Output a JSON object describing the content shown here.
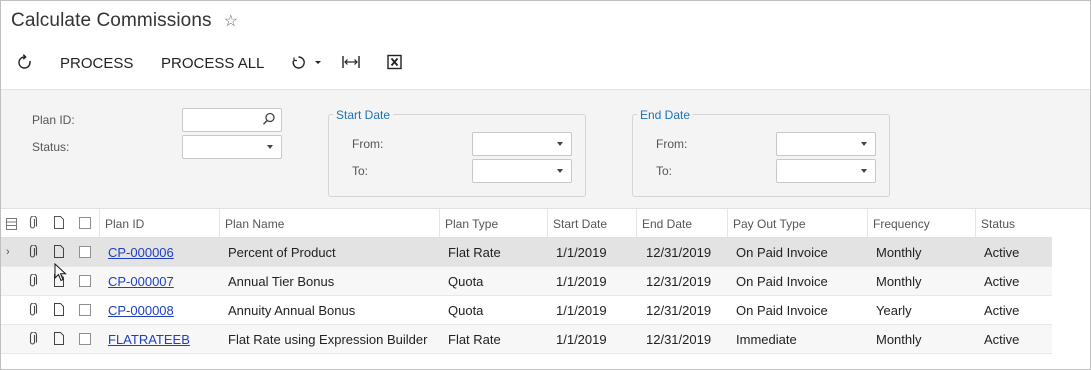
{
  "page": {
    "title": "Calculate Commissions"
  },
  "toolbar": {
    "process_label": "PROCESS",
    "process_all_label": "PROCESS ALL"
  },
  "filters": {
    "plan_id_label": "Plan ID:",
    "plan_id_value": "",
    "status_label": "Status:",
    "status_value": "",
    "start_date": {
      "title": "Start Date",
      "from_label": "From:",
      "to_label": "To:",
      "from_value": "",
      "to_value": ""
    },
    "end_date": {
      "title": "End Date",
      "from_label": "From:",
      "to_label": "To:",
      "from_value": "",
      "to_value": ""
    }
  },
  "grid": {
    "columns": [
      "Plan ID",
      "Plan Name",
      "Plan Type",
      "Start Date",
      "End Date",
      "Pay Out Type",
      "Frequency",
      "Status"
    ],
    "rows": [
      {
        "plan_id": "CP-000006",
        "plan_name": "Percent of Product",
        "plan_type": "Flat Rate",
        "start_date": "1/1/2019",
        "end_date": "12/31/2019",
        "pay_out_type": "On Paid Invoice",
        "frequency": "Monthly",
        "status": "Active"
      },
      {
        "plan_id": "CP-000007",
        "plan_name": "Annual Tier Bonus",
        "plan_type": "Quota",
        "start_date": "1/1/2019",
        "end_date": "12/31/2019",
        "pay_out_type": "On Paid Invoice",
        "frequency": "Monthly",
        "status": "Active"
      },
      {
        "plan_id": "CP-000008",
        "plan_name": "Annuity Annual Bonus",
        "plan_type": "Quota",
        "start_date": "1/1/2019",
        "end_date": "12/31/2019",
        "pay_out_type": "On Paid Invoice",
        "frequency": "Yearly",
        "status": "Active"
      },
      {
        "plan_id": "FLATRATEEB",
        "plan_name": "Flat Rate using Expression Builder",
        "plan_type": "Flat Rate",
        "start_date": "1/1/2019",
        "end_date": "12/31/2019",
        "pay_out_type": "Immediate",
        "frequency": "Monthly",
        "status": "Active"
      }
    ]
  },
  "icons": {
    "favorite": "star-outline-icon",
    "refresh": "refresh-icon",
    "undo_menu": "undo-dropdown-icon",
    "fit_width": "fit-columns-icon",
    "export_excel": "excel-export-icon"
  }
}
